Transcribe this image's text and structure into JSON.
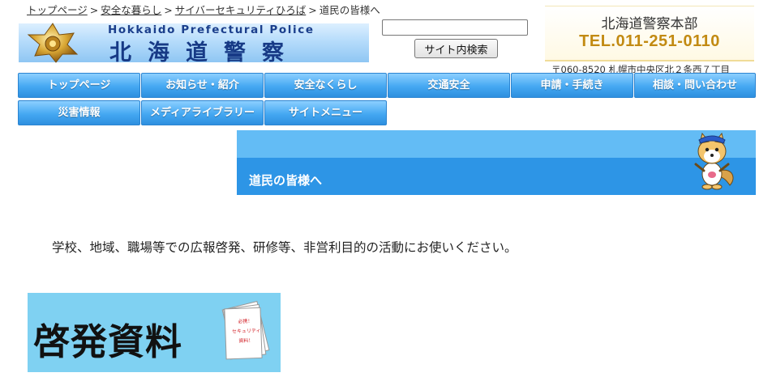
{
  "breadcrumb": {
    "items": [
      "トップページ",
      "安全な暮らし",
      "サイバーセキュリティひろば"
    ],
    "separator": ">",
    "current": "道民の皆様へ"
  },
  "logo": {
    "en": "Hokkaido Prefectural Police",
    "ja": "北海道警察"
  },
  "search": {
    "placeholder": "",
    "button_label": "サイト内検索"
  },
  "contact": {
    "org": "北海道警察本部",
    "tel": "TEL.011-251-0110",
    "address": "〒060-8520 札幌市中央区北２条西７丁目"
  },
  "nav": {
    "row1": [
      "トップページ",
      "お知らせ・紹介",
      "安全なくらし",
      "交通安全",
      "申請・手続き",
      "相談・問い合わせ"
    ],
    "row2": [
      "災害情報",
      "メディアライブラリー",
      "サイトメニュー"
    ]
  },
  "banner": {
    "title": "道民の皆様へ"
  },
  "intro": "学校、地域、職場等での広報啓発、研修等、非営利目的の活動にお使いください。",
  "resource": {
    "title": "啓発資料",
    "paper_lines": [
      "必携！",
      "セキュリティ",
      "資料！"
    ]
  },
  "colors": {
    "nav": "#3d9fec",
    "banner_top": "#63bcf5",
    "banner_band": "#2d95e6",
    "tel": "#c28a12",
    "resource_bg": "#7fd1f2"
  }
}
